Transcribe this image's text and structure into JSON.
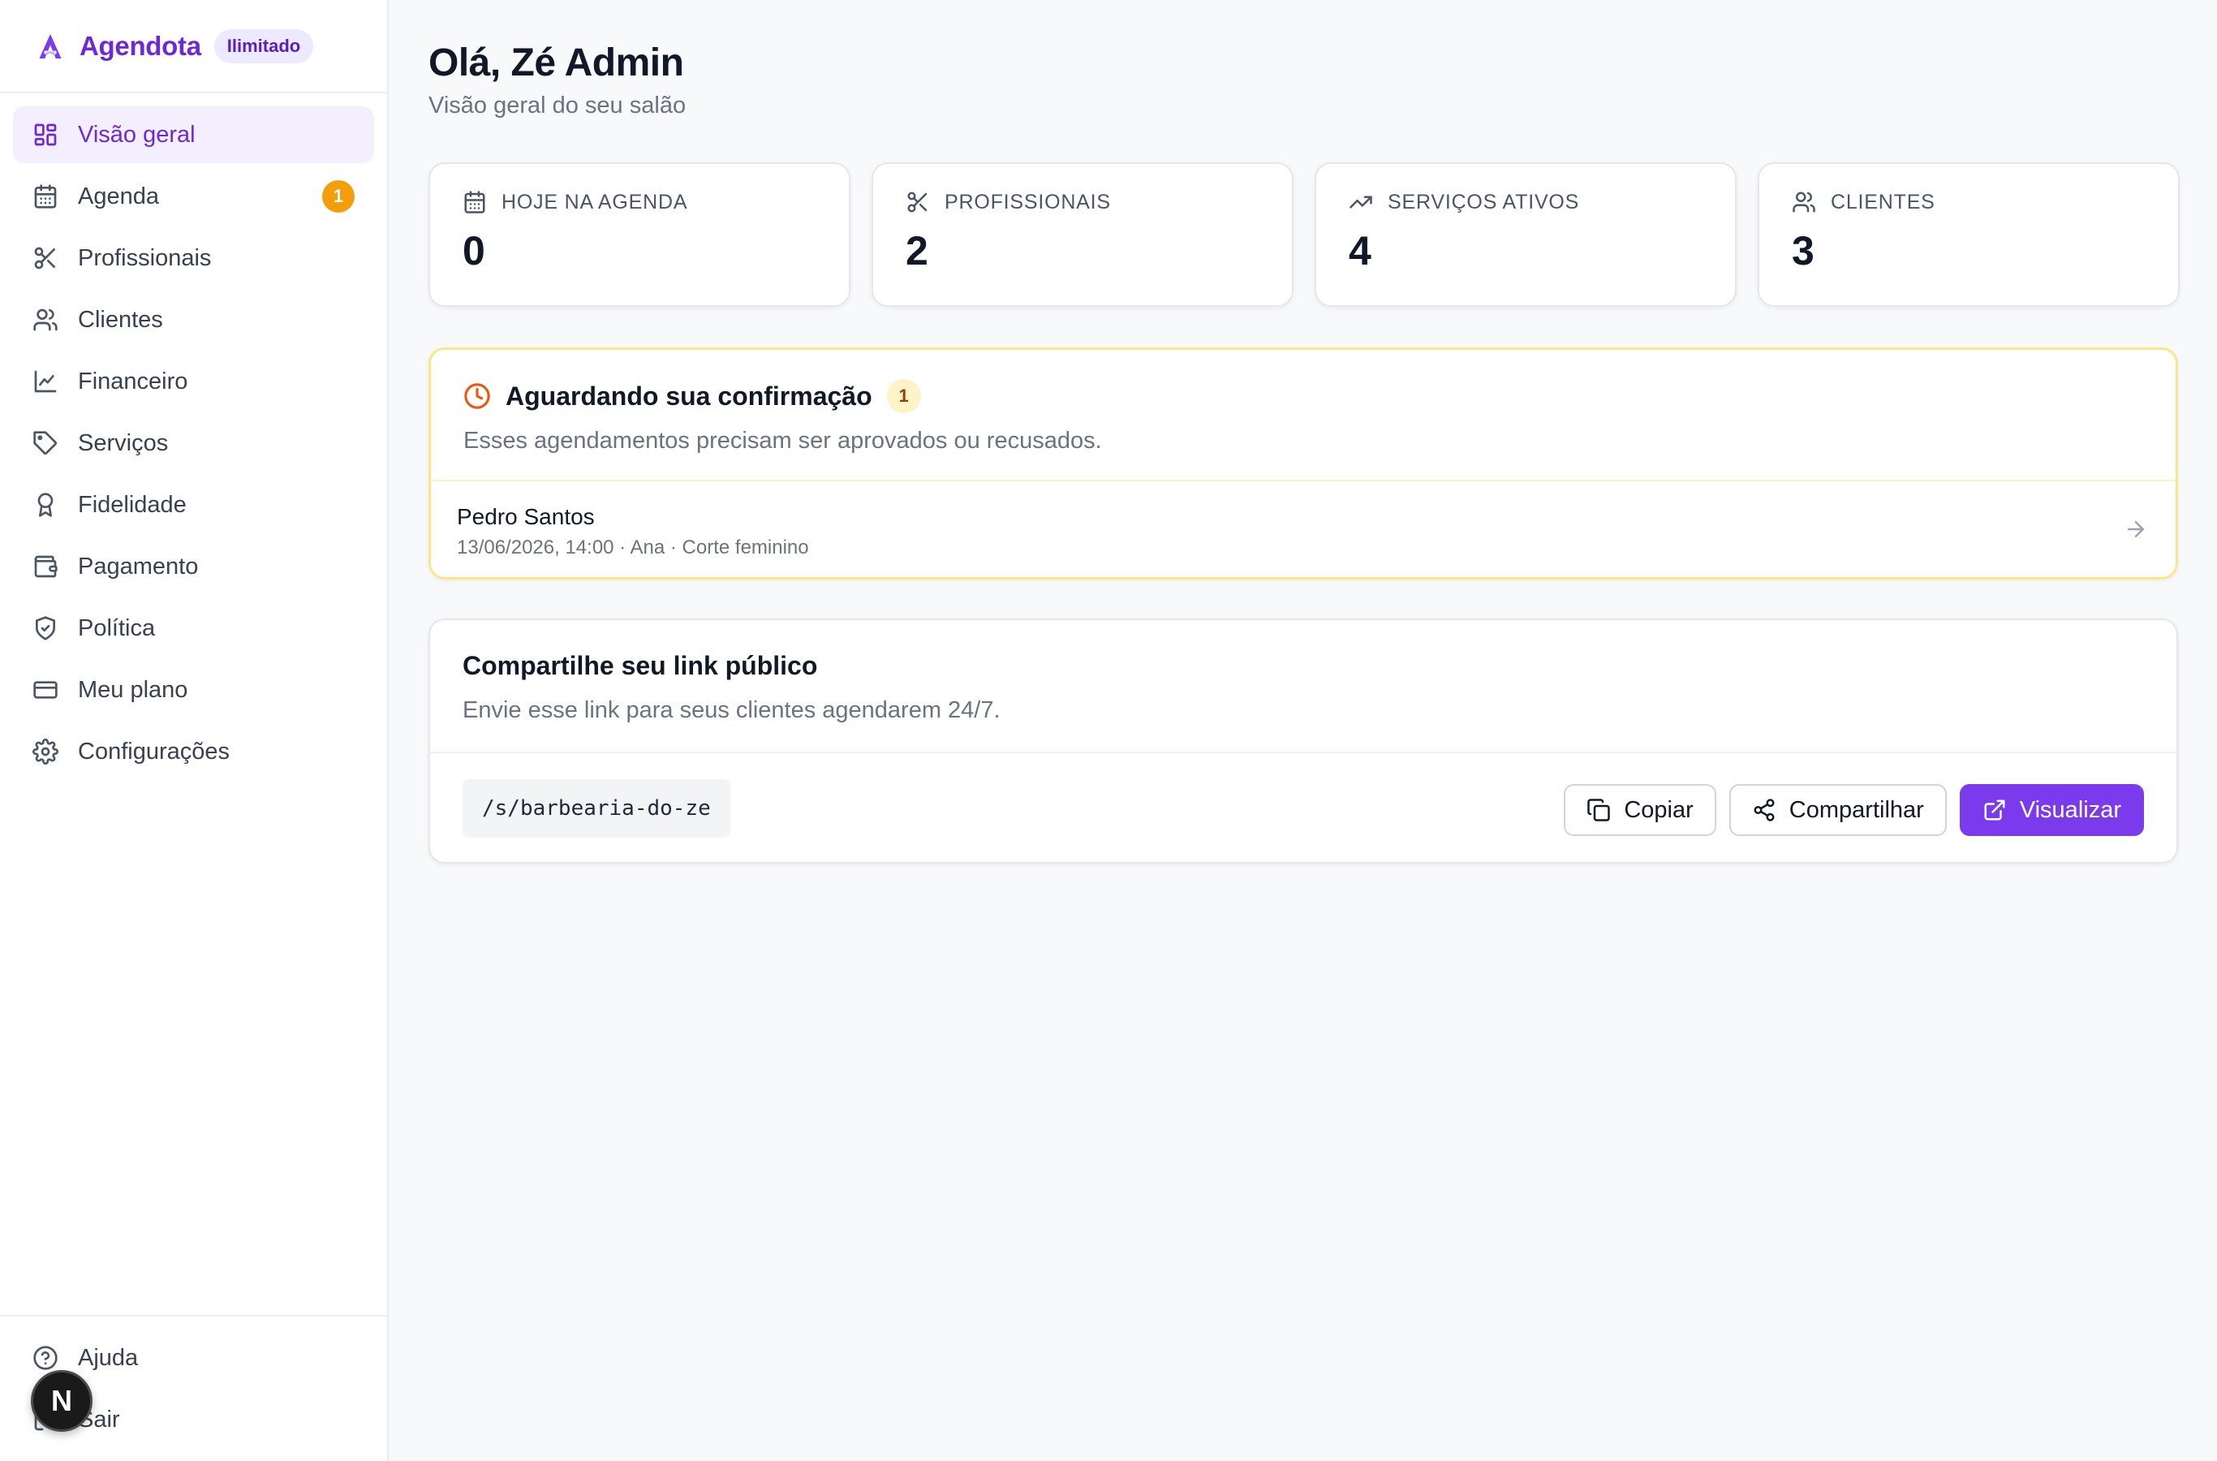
{
  "brand": {
    "name": "Agendota",
    "plan": "Ilimitado"
  },
  "sidebar": {
    "items": [
      {
        "label": "Visão geral",
        "icon": "dashboard-icon",
        "active": true
      },
      {
        "label": "Agenda",
        "icon": "calendar-icon",
        "badge": "1"
      },
      {
        "label": "Profissionais",
        "icon": "scissors-icon"
      },
      {
        "label": "Clientes",
        "icon": "users-icon"
      },
      {
        "label": "Financeiro",
        "icon": "line-chart-icon"
      },
      {
        "label": "Serviços",
        "icon": "tag-icon"
      },
      {
        "label": "Fidelidade",
        "icon": "award-icon"
      },
      {
        "label": "Pagamento",
        "icon": "wallet-icon"
      },
      {
        "label": "Política",
        "icon": "shield-check-icon"
      },
      {
        "label": "Meu plano",
        "icon": "credit-card-icon"
      },
      {
        "label": "Configurações",
        "icon": "settings-icon"
      }
    ],
    "footer": [
      {
        "label": "Ajuda",
        "icon": "help-circle-icon"
      },
      {
        "label": "Sair",
        "icon": "logout-icon"
      }
    ],
    "dev_indicator": "N"
  },
  "header": {
    "title": "Olá, Zé Admin",
    "subtitle": "Visão geral do seu salão"
  },
  "stats": [
    {
      "label": "HOJE NA AGENDA",
      "value": "0",
      "icon": "calendar-icon"
    },
    {
      "label": "PROFISSIONAIS",
      "value": "2",
      "icon": "scissors-icon"
    },
    {
      "label": "SERVIÇOS ATIVOS",
      "value": "4",
      "icon": "trending-up-icon"
    },
    {
      "label": "CLIENTES",
      "value": "3",
      "icon": "users-icon"
    }
  ],
  "pending": {
    "title": "Aguardando sua confirmação",
    "count": "1",
    "description": "Esses agendamentos precisam ser aprovados ou recusados.",
    "items": [
      {
        "name": "Pedro Santos",
        "meta": "13/06/2026, 14:00 · Ana · Corte feminino"
      }
    ]
  },
  "share": {
    "title": "Compartilhe seu link público",
    "description": "Envie esse link para seus clientes agendarem 24/7.",
    "link": "/s/barbearia-do-ze",
    "copy_label": "Copiar",
    "share_label": "Compartilhar",
    "view_label": "Visualizar"
  },
  "colors": {
    "accent": "#7c3aed",
    "accent_dark": "#6d28d9",
    "badge": "#f59e0b",
    "pending_border": "#fde68a",
    "clock": "#ea580c"
  }
}
